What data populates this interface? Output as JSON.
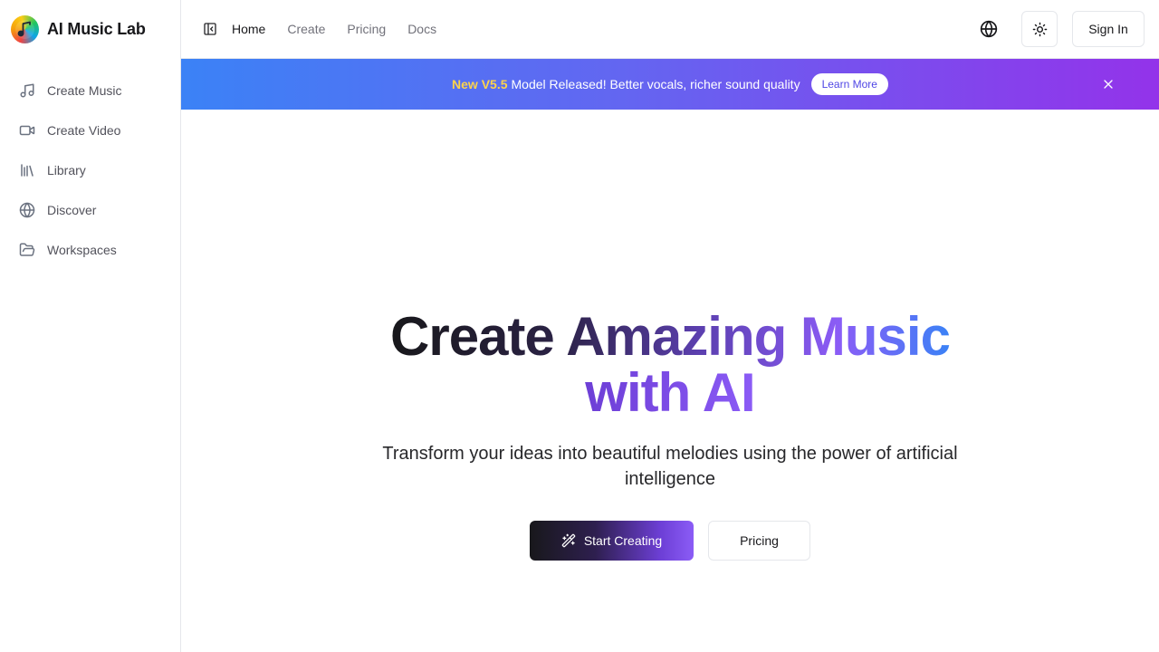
{
  "brand": {
    "name": "AI Music Lab",
    "logo_icon": "music-note-icon"
  },
  "sidebar": {
    "items": [
      {
        "label": "Create Music",
        "icon": "music-note-icon"
      },
      {
        "label": "Create Video",
        "icon": "video-camera-icon"
      },
      {
        "label": "Library",
        "icon": "library-icon"
      },
      {
        "label": "Discover",
        "icon": "globe-icon"
      },
      {
        "label": "Workspaces",
        "icon": "folder-open-icon"
      }
    ]
  },
  "topbar": {
    "toggle_icon": "sidebar-toggle-icon",
    "links": [
      "Home",
      "Create",
      "Pricing",
      "Docs"
    ],
    "active_link": "Home",
    "language_icon": "globe-icon",
    "theme_icon": "sun-icon",
    "sign_in": "Sign In"
  },
  "banner": {
    "highlight": "New V5.5",
    "message": "Model Released! Better vocals, richer sound quality",
    "button": "Learn More",
    "close_icon": "close-icon",
    "colors": {
      "start": "#3b82f6",
      "end": "#9333ea",
      "highlight": "#fcd34d"
    }
  },
  "hero": {
    "title_line1": "Create Amazing Music",
    "title_line2": "with AI",
    "subtitle": "Transform your ideas into beautiful melodies using the power of artificial intelligence",
    "primary_cta": "Start Creating",
    "primary_cta_icon": "magic-wand-icon",
    "secondary_cta": "Pricing"
  }
}
